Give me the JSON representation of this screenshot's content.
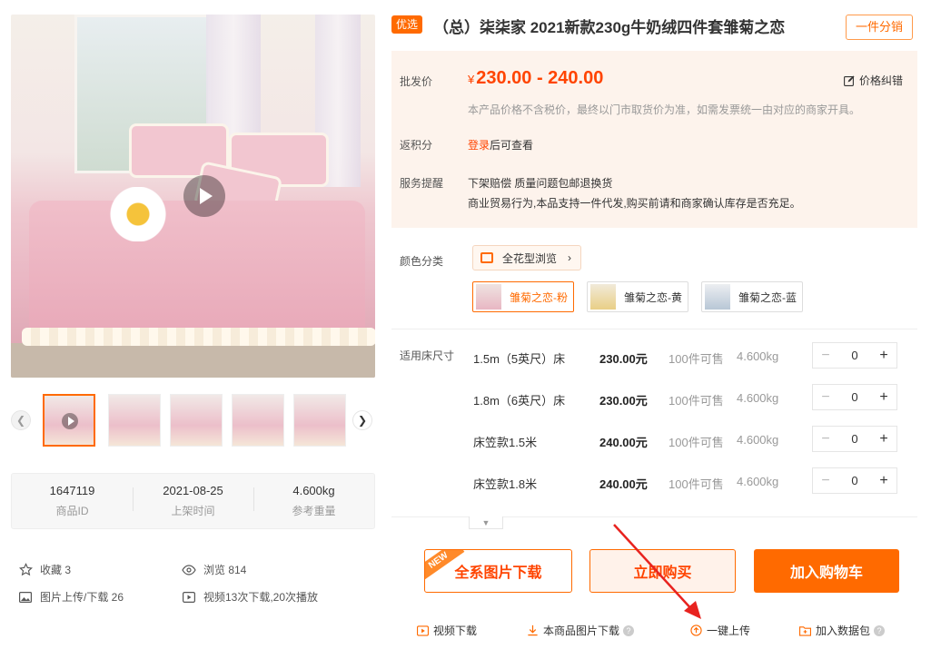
{
  "gallery": {
    "thumb_count": 5,
    "prev_icon": "chevron-left-icon",
    "next_icon": "chevron-right-icon"
  },
  "product_info": {
    "id_value": "1647119",
    "id_label": "商品ID",
    "date_value": "2021-08-25",
    "date_label": "上架时间",
    "weight_value": "4.600kg",
    "weight_label": "参考重量"
  },
  "stats": {
    "favorites": "收藏 3",
    "views": "浏览 814",
    "image_uploads": "图片上传/下载 26",
    "video_stats": "视频13次下载,20次播放"
  },
  "header": {
    "tag": "优选",
    "title": "（总）柒柒家 2021新款230g牛奶绒四件套雏菊之恋",
    "distribute_button": "一件分销"
  },
  "pricing": {
    "wholesale_label": "批发价",
    "currency": "¥",
    "price_range": "230.00 - 240.00",
    "price_fix_label": "价格纠错",
    "tax_note": "本产品价格不含税价，最终以门市取货价为准，如需发票统一由对应的商家开具。",
    "points_label": "返积分",
    "login_link": "登录",
    "login_suffix": "后可查看",
    "service_label": "服务提醒",
    "service_line1": "下架赔偿   质量问题包邮退换货",
    "service_line2": "商业贸易行为,本品支持一件代发,购买前请和商家确认库存是否充足。"
  },
  "colors": {
    "label": "颜色分类",
    "browse_button": "全花型浏览",
    "options": [
      {
        "label": "雏菊之恋-粉",
        "swatch": "#e8b7c3",
        "selected": true
      },
      {
        "label": "雏菊之恋-黄",
        "swatch": "#e9cf86",
        "selected": false
      },
      {
        "label": "雏菊之恋-蓝",
        "swatch": "#b8c7d6",
        "selected": false
      }
    ]
  },
  "sizes": {
    "label": "适用床尺寸",
    "rows": [
      {
        "name": "1.5m（5英尺）床",
        "price": "230.00元",
        "stock": "100件可售",
        "weight": "4.600kg",
        "qty": "0"
      },
      {
        "name": "1.8m（6英尺）床",
        "price": "230.00元",
        "stock": "100件可售",
        "weight": "4.600kg",
        "qty": "0"
      },
      {
        "name": "床笠款1.5米",
        "price": "240.00元",
        "stock": "100件可售",
        "weight": "4.600kg",
        "qty": "0"
      },
      {
        "name": "床笠款1.8米",
        "price": "240.00元",
        "stock": "100件可售",
        "weight": "4.600kg",
        "qty": "0"
      }
    ]
  },
  "actions": {
    "download_all": "全系图片下载",
    "new_badge": "NEW",
    "buy_now": "立即购买",
    "add_cart": "加入购物车"
  },
  "bottom_links": {
    "video_download": "视频下载",
    "image_download": "本商品图片下载",
    "one_click_upload": "一键上传",
    "add_package": "加入数据包"
  },
  "colors_theme": {
    "accent": "#ff6a00",
    "price": "#ff4400",
    "panel_bg": "#fdf3ec"
  }
}
